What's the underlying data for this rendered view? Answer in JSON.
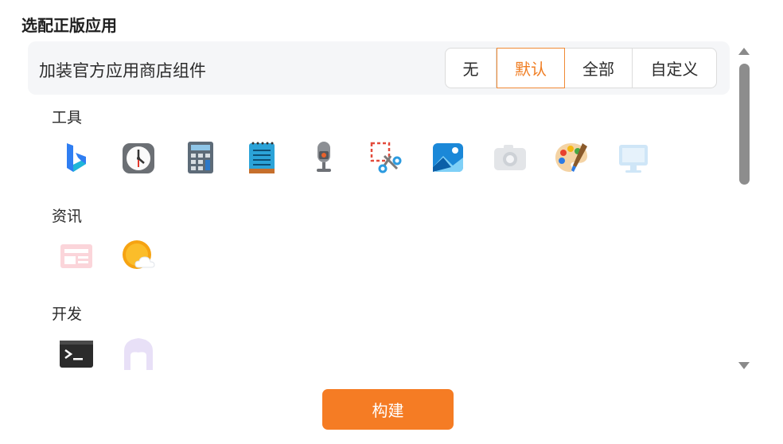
{
  "section_title": "选配正版应用",
  "option": {
    "label": "加装官方应用商店组件",
    "choices": [
      "无",
      "默认",
      "全部",
      "自定义"
    ],
    "selected": "默认"
  },
  "categories": [
    {
      "name": "工具",
      "apps": [
        "bing-icon",
        "alarm-clock-icon",
        "calculator-icon",
        "notepad-icon",
        "voice-recorder-icon",
        "snipping-tool-icon",
        "photos-icon",
        "camera-icon",
        "paint-icon",
        "dev-home-icon"
      ]
    },
    {
      "name": "资讯",
      "apps": [
        "news-icon",
        "weather-icon"
      ]
    },
    {
      "name": "开发",
      "apps": [
        "terminal-icon",
        "dev-home-arch-icon"
      ]
    }
  ],
  "build_button": "构建",
  "colors": {
    "accent": "#f57c24",
    "panel_bg": "#f5f6f8"
  }
}
